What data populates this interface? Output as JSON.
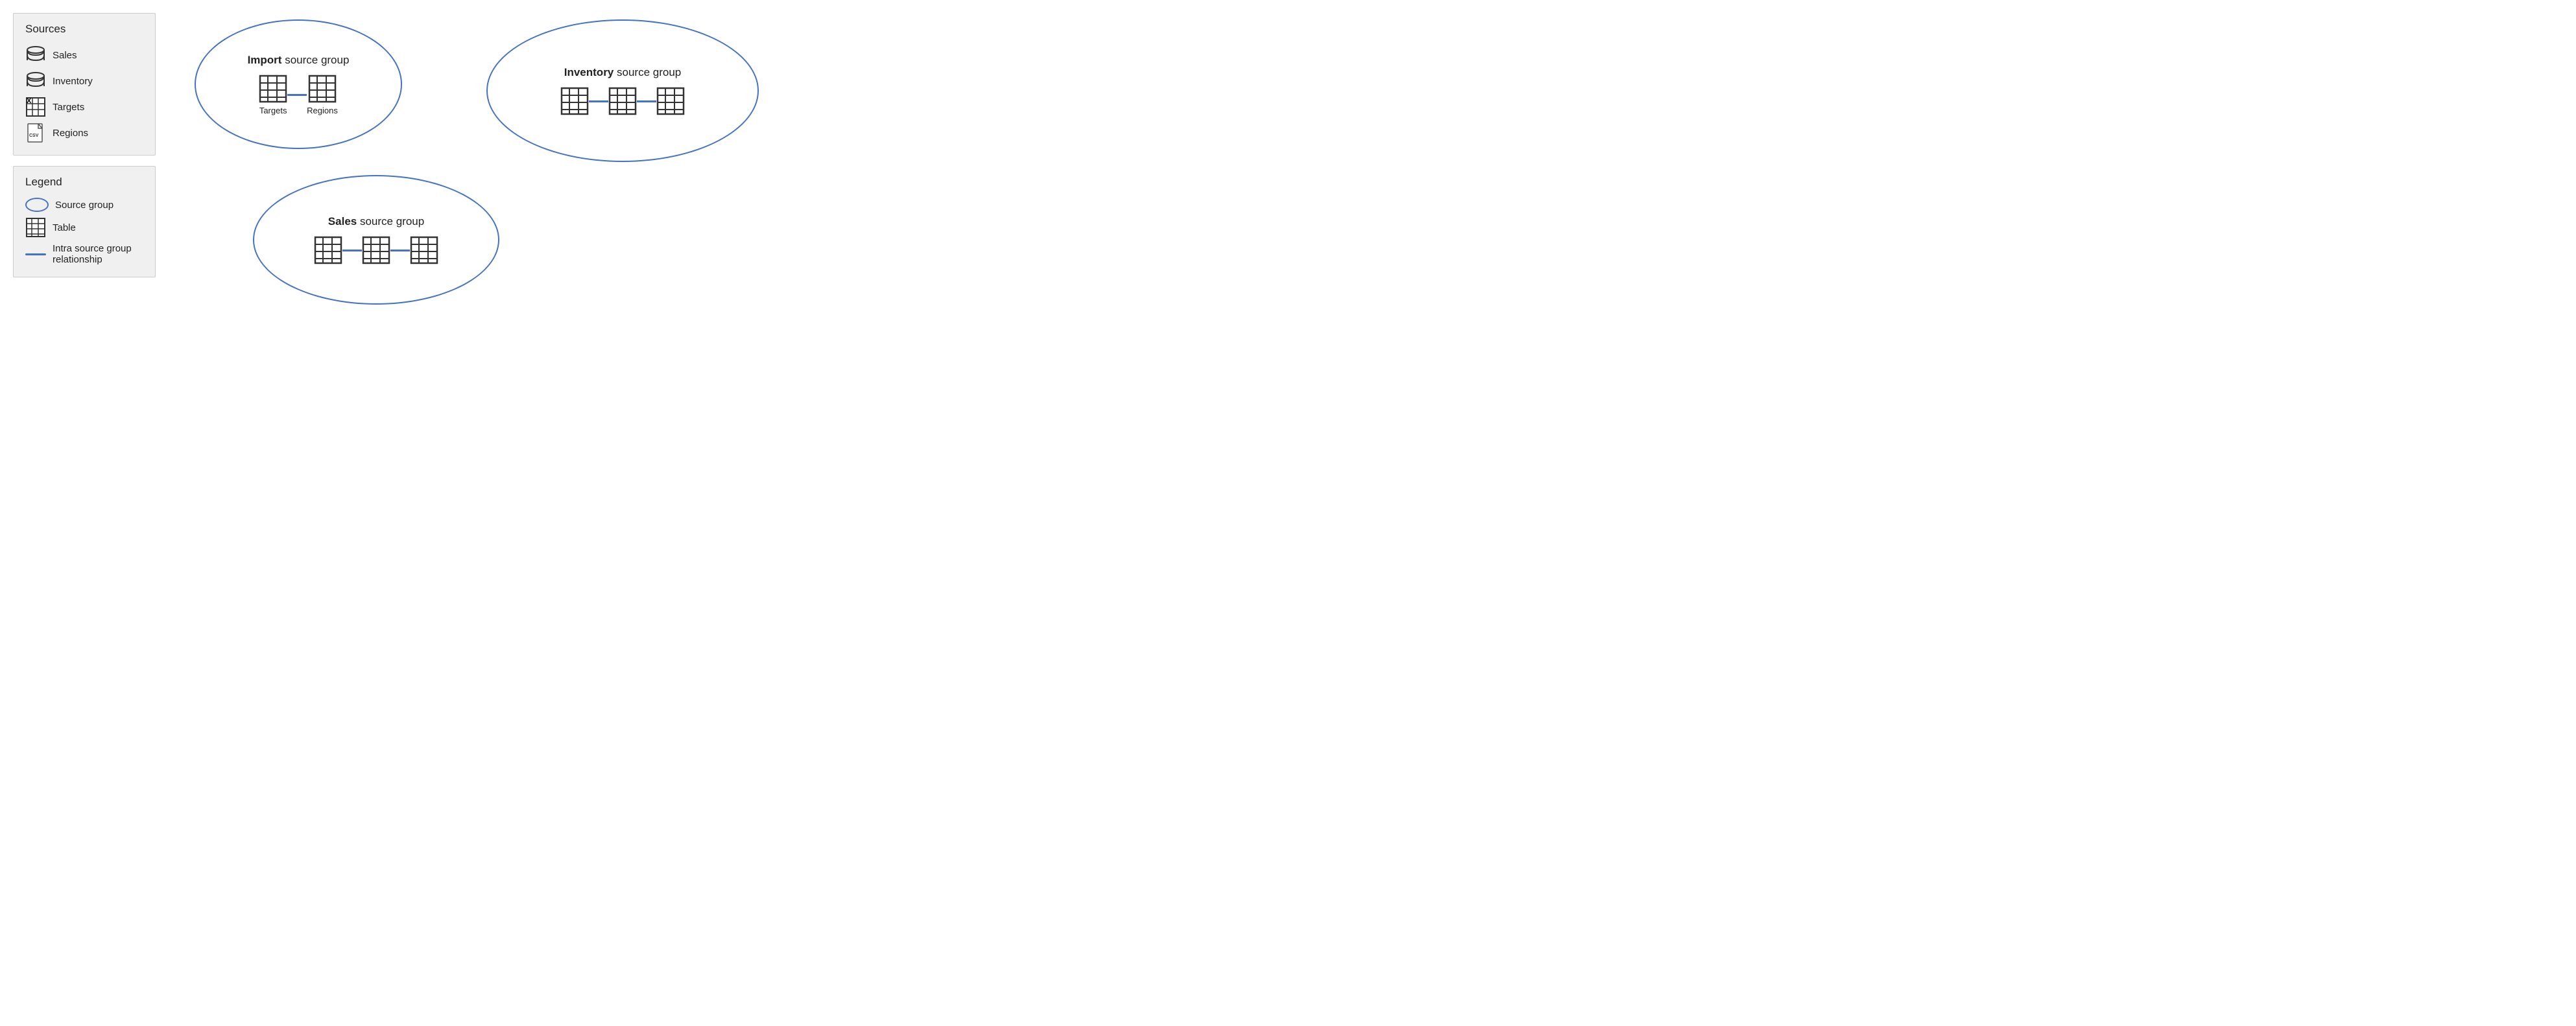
{
  "left": {
    "sources_title": "Sources",
    "sources_items": [
      {
        "label": "Sales",
        "type": "database"
      },
      {
        "label": "Inventory",
        "type": "database"
      },
      {
        "label": "Targets",
        "type": "excel"
      },
      {
        "label": "Regions",
        "type": "csv"
      }
    ],
    "legend_title": "Legend",
    "legend_items": [
      {
        "label": "Source group",
        "type": "ellipse"
      },
      {
        "label": "Table",
        "type": "table"
      },
      {
        "label": "Intra source group relationship",
        "type": "line"
      }
    ]
  },
  "diagram": {
    "import_group": {
      "title_bold": "Import",
      "title_rest": " source group",
      "tables": [
        {
          "label": "Targets"
        },
        {
          "label": "Regions"
        }
      ]
    },
    "inventory_group": {
      "title_bold": "Inventory",
      "title_rest": " source group",
      "tables": [
        {
          "label": ""
        },
        {
          "label": ""
        },
        {
          "label": ""
        }
      ]
    },
    "sales_group": {
      "title_bold": "Sales",
      "title_rest": " source group",
      "tables": [
        {
          "label": ""
        },
        {
          "label": ""
        },
        {
          "label": ""
        }
      ]
    }
  },
  "colors": {
    "blue": "#4472c4",
    "panel_bg": "#f0f0f0"
  }
}
